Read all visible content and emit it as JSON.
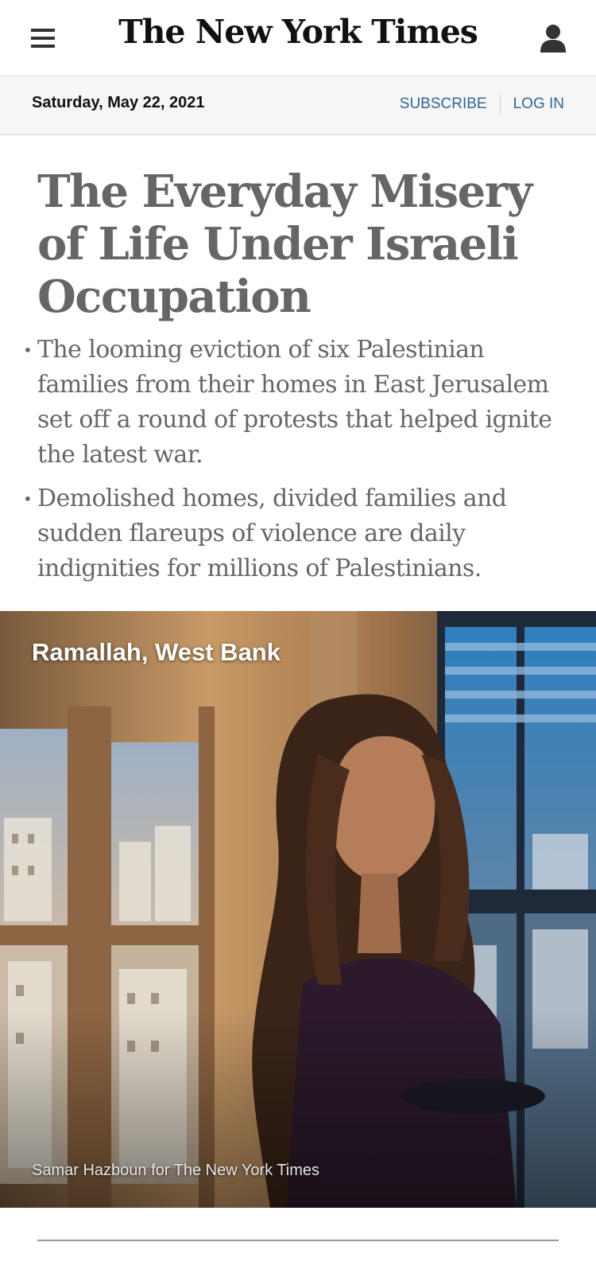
{
  "header": {
    "logo_text": "The New York Times",
    "menu_icon": "hamburger-menu-icon",
    "account_icon": "user-account-icon"
  },
  "datebar": {
    "date": "Saturday, May 22, 2021",
    "subscribe_label": "SUBSCRIBE",
    "login_label": "LOG IN",
    "link_color": "#326891"
  },
  "article": {
    "headline": "The Everyday Misery of Life Under Israeli Occupation",
    "summary": [
      "The looming eviction of six Palestinian families from their homes in East Jerusalem set off a round of protests that helped ignite the latest war.",
      "Demolished homes, divided families and sudden flareups of violence are daily indignities for millions of Palestinians."
    ],
    "bullet_glyph": "•",
    "hero": {
      "location_label": "Ramallah, West Bank",
      "credit": "Samar Hazboun for The New York Times"
    }
  },
  "colors": {
    "headline": "#666666",
    "body_text": "#666666",
    "datebar_bg": "#f6f6f6"
  }
}
